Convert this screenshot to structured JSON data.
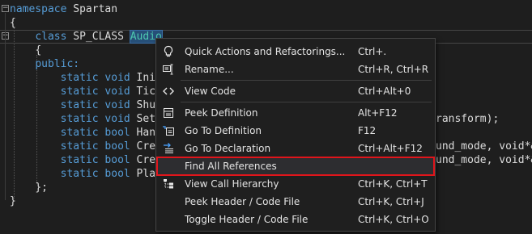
{
  "code": {
    "line1": {
      "kw": "namespace",
      "name": "Spartan"
    },
    "line2": "{",
    "line3": {
      "kw": "class",
      "macro": "SP_CLASS",
      "name": "Audio"
    },
    "line4": "{",
    "line5": {
      "kw": "public:"
    },
    "members": [
      {
        "type": "static void",
        "name": "Init"
      },
      {
        "type": "static void",
        "name": "Tick"
      },
      {
        "type": "static void",
        "name": "Shut"
      },
      {
        "type": "static void",
        "name": "SetL",
        "tail": "ransform);"
      },
      {
        "type": "static bool",
        "name": "Hand"
      },
      {
        "type": "static bool",
        "name": "Crea",
        "tail": "und_mode, void*&"
      },
      {
        "type": "static bool",
        "name": "Crea",
        "tail": "und_mode, void*&"
      },
      {
        "type": "static bool",
        "name": "Play"
      }
    ],
    "line14": "};",
    "line15": "}"
  },
  "menu": {
    "items": [
      {
        "label": "Quick Actions and Refactorings...",
        "shortcut": "Ctrl+.",
        "icon": "lightbulb-icon"
      },
      {
        "label": "Rename...",
        "shortcut": "Ctrl+R, Ctrl+R",
        "icon": "rename-icon"
      },
      {
        "label": "View Code",
        "shortcut": "Ctrl+Alt+0",
        "icon": "code-icon"
      },
      {
        "label": "Peek Definition",
        "shortcut": "Alt+F12",
        "icon": "peek-definition-icon"
      },
      {
        "label": "Go To Definition",
        "shortcut": "F12",
        "icon": "go-to-definition-icon"
      },
      {
        "label": "Go To Declaration",
        "shortcut": "Ctrl+Alt+F12",
        "icon": "go-to-declaration-icon"
      },
      {
        "label": "Find All References",
        "shortcut": "",
        "icon": ""
      },
      {
        "label": "View Call Hierarchy",
        "shortcut": "Ctrl+K, Ctrl+T",
        "icon": "call-hierarchy-icon"
      },
      {
        "label": "Peek Header / Code File",
        "shortcut": "Ctrl+K, Ctrl+J",
        "icon": ""
      },
      {
        "label": "Toggle Header / Code File",
        "shortcut": "Ctrl+K, Ctrl+O",
        "icon": ""
      }
    ],
    "highlight_color": "#e0151b"
  }
}
